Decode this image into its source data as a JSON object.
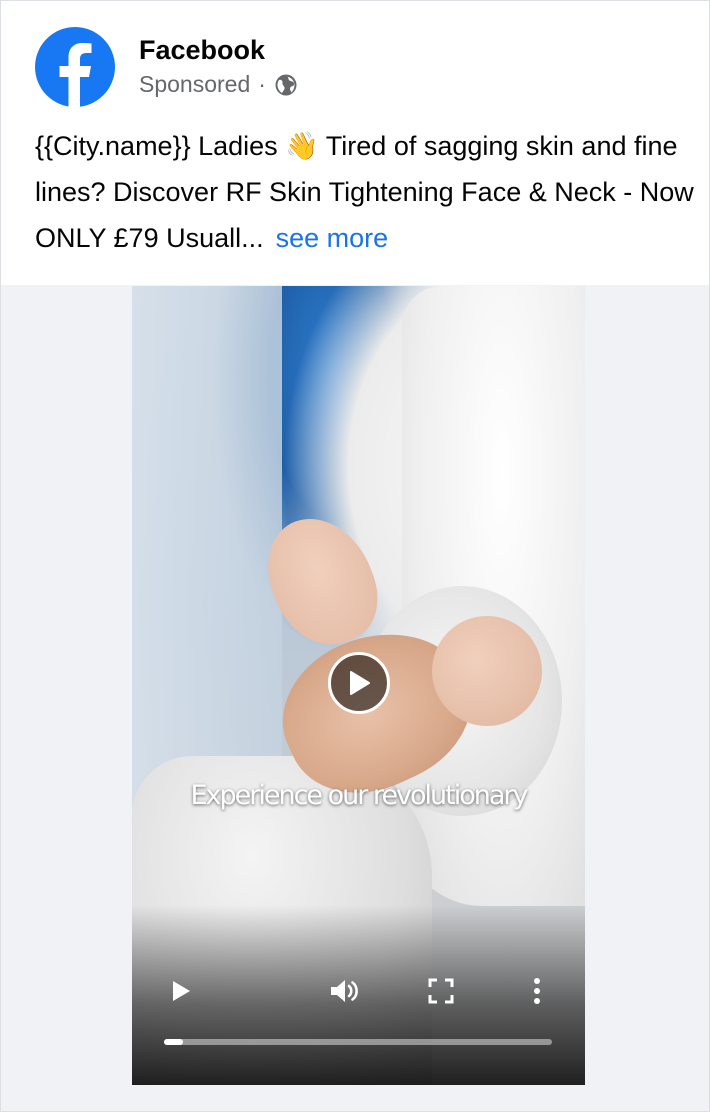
{
  "post": {
    "page_name": "Facebook",
    "sponsored_label": "Sponsored",
    "separator": "·",
    "caption_text": "{{City.name}} Ladies 👋 Tired of sagging skin and fine lines? Discover RF Skin Tightening Face & Neck - Now ONLY £79 Usuall...",
    "see_more_label": "see more"
  },
  "video": {
    "subtitle": "Experience our revolutionary",
    "progress": 0.05
  },
  "icons": {
    "avatar": "facebook-logo-icon",
    "audience": "globe-icon",
    "center_play": "play-icon",
    "play": "play-icon",
    "volume": "volume-icon",
    "fullscreen": "fullscreen-icon",
    "more": "more-vertical-icon"
  },
  "colors": {
    "brand": "#1877f2",
    "link": "#1b74e4",
    "secondary_text": "#65676b"
  }
}
